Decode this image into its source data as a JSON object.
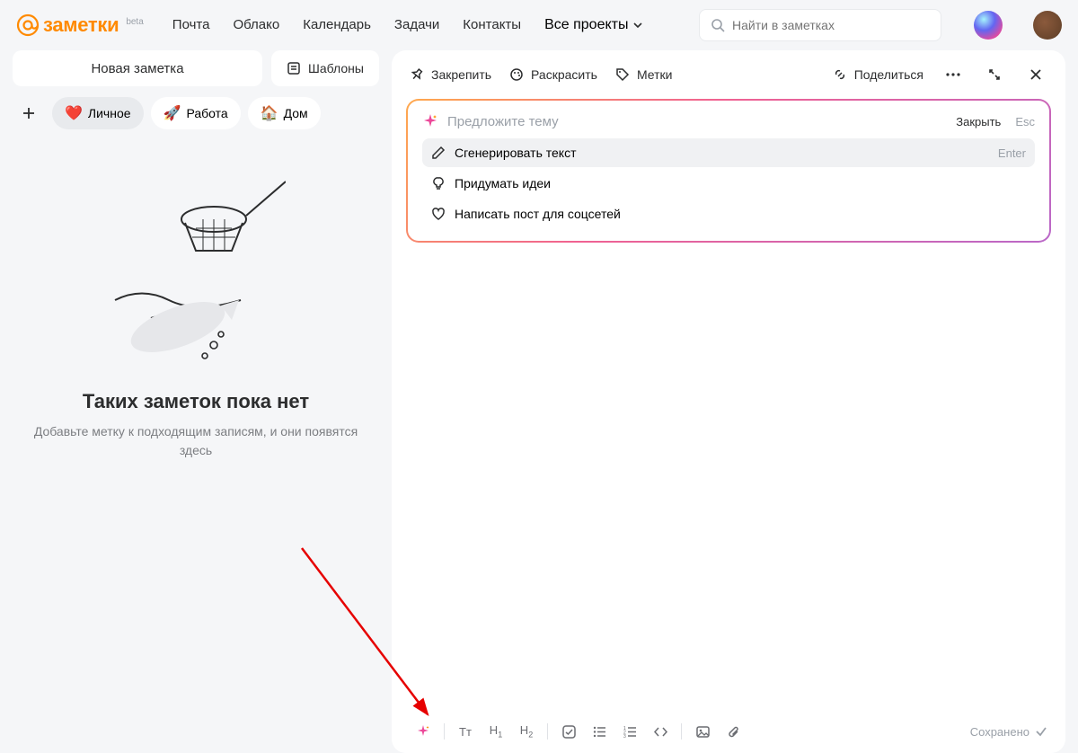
{
  "header": {
    "logo": "заметки",
    "beta": "beta",
    "nav": {
      "mail": "Почта",
      "cloud": "Облако",
      "calendar": "Календарь",
      "tasks": "Задачи",
      "contacts": "Контакты",
      "projects": "Все проекты"
    },
    "search_placeholder": "Найти в заметках"
  },
  "sidebar": {
    "new_note": "Новая заметка",
    "templates": "Шаблоны",
    "tags": [
      {
        "emoji": "❤️",
        "label": "Личное",
        "active": true
      },
      {
        "emoji": "🚀",
        "label": "Работа",
        "active": false
      },
      {
        "emoji": "🏠",
        "label": "Дом",
        "active": false
      }
    ],
    "empty": {
      "title": "Таких заметок пока нет",
      "subtitle": "Добавьте метку к подходящим записям, и они появятся здесь"
    }
  },
  "editor": {
    "toolbar": {
      "pin": "Закрепить",
      "color": "Раскрасить",
      "tags": "Метки",
      "share": "Поделиться"
    },
    "ai": {
      "placeholder": "Предложите тему",
      "close": "Закрыть",
      "esc": "Esc",
      "options": [
        {
          "label": "Сгенерировать текст",
          "hint": "Enter",
          "selected": true
        },
        {
          "label": "Придумать идеи",
          "hint": "",
          "selected": false
        },
        {
          "label": "Написать пост для соцсетей",
          "hint": "",
          "selected": false
        }
      ]
    },
    "saved": "Сохранено"
  }
}
